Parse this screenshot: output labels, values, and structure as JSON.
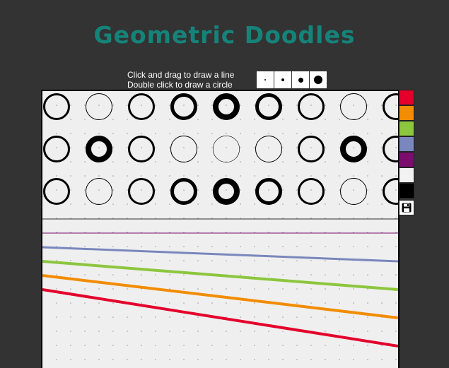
{
  "app": {
    "title": "Geometric Doodles"
  },
  "instructions": {
    "line1": "Click and drag to draw a line",
    "line2": "Double click to draw a circle"
  },
  "brush_sizes": [
    1,
    2,
    3,
    4
  ],
  "palette": {
    "colors": [
      "#e4002b",
      "#f28c00",
      "#8cc63e",
      "#7a87bd",
      "#7a0d6e",
      "#f2f2f2",
      "#000000"
    ],
    "save_icon": "floppy-disk-icon"
  },
  "canvas": {
    "background": "#efefef",
    "dot_color": "#9a9a9a"
  }
}
